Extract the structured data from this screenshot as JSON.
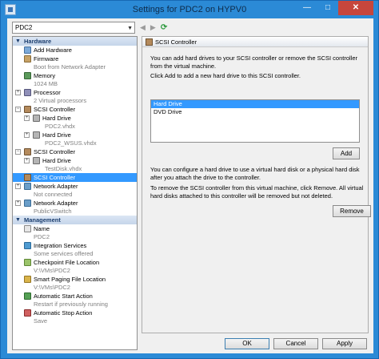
{
  "window": {
    "title": "Settings for PDC2 on HYPV0"
  },
  "vm_select": {
    "value": "PDC2"
  },
  "tree": {
    "hardware_label": "Hardware",
    "management_label": "Management",
    "hardware": [
      {
        "label": "Add Hardware",
        "sub": ""
      },
      {
        "label": "Firmware",
        "sub": "Boot from Network Adapter"
      },
      {
        "label": "Memory",
        "sub": "1024 MB"
      },
      {
        "label": "Processor",
        "sub": "2 Virtual processors"
      },
      {
        "label": "SCSI Controller",
        "sub": ""
      },
      {
        "label": "Hard Drive",
        "sub": "PDC2.vhdx"
      },
      {
        "label": "Hard Drive",
        "sub": "PDC2_WSUS.vhdx"
      },
      {
        "label": "SCSI Controller",
        "sub": ""
      },
      {
        "label": "Hard Drive",
        "sub": "TestDisk.vhdx"
      },
      {
        "label": "SCSI Controller",
        "sub": ""
      },
      {
        "label": "Network Adapter",
        "sub": "Not connected"
      },
      {
        "label": "Network Adapter",
        "sub": "PublicVSwitch"
      }
    ],
    "management": [
      {
        "label": "Name",
        "sub": "PDC2"
      },
      {
        "label": "Integration Services",
        "sub": "Some services offered"
      },
      {
        "label": "Checkpoint File Location",
        "sub": "V:\\VMs\\PDC2"
      },
      {
        "label": "Smart Paging File Location",
        "sub": "V:\\VMs\\PDC2"
      },
      {
        "label": "Automatic Start Action",
        "sub": "Restart if previously running"
      },
      {
        "label": "Automatic Stop Action",
        "sub": "Save"
      }
    ]
  },
  "panel": {
    "header": "SCSI Controller",
    "intro": "You can add hard drives to your SCSI controller or remove the SCSI controller from the virtual machine.",
    "instruction": "Click Add to add a new hard drive to this SCSI controller.",
    "drive_options": [
      "Hard Drive",
      "DVD Drive"
    ],
    "add_label": "Add",
    "configure_text": "You can configure a hard drive to use a virtual hard disk or a physical hard disk after you attach the drive to the controller.",
    "remove_text": "To remove the SCSI controller from this virtual machine, click Remove. All virtual hard disks attached to this controller will be removed but not deleted.",
    "remove_label": "Remove"
  },
  "footer": {
    "ok": "OK",
    "cancel": "Cancel",
    "apply": "Apply"
  }
}
